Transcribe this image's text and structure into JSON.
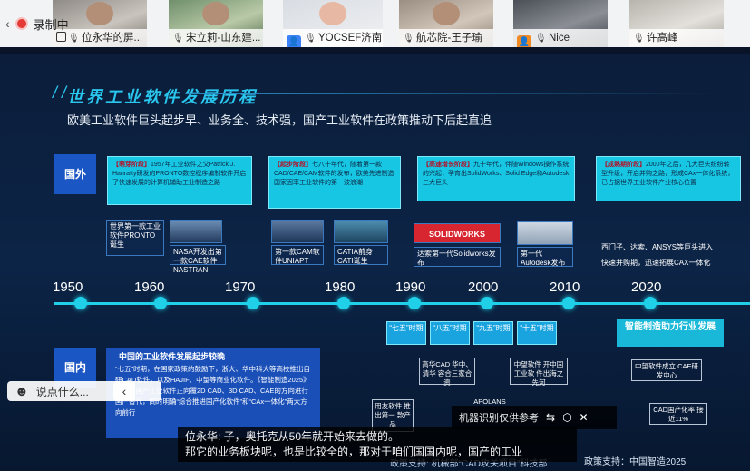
{
  "topbar": {
    "recording_label": "录制中",
    "participants": [
      {
        "name": "位永华的屏..."
      },
      {
        "name": "宋立莉-山东建..."
      },
      {
        "name": "YOCSEF济南"
      },
      {
        "name": "航芯院-王子瑜"
      },
      {
        "name": "Nice"
      },
      {
        "name": "许高峰"
      }
    ]
  },
  "slide": {
    "title": "世界工业软件发展历程",
    "subtitle": "欧美工业软件巨头起步早、业务全、技术强，国产工业软件在政策推动下后起直追",
    "row_foreign": "国外",
    "row_domestic": "国内",
    "foreign_boxes": [
      {
        "key": "【萌芽阶段】",
        "text": "1957年工业软件之父Patrick J. Hanratty研发的PRONTO数控程序编制软件开启了快速发展的计算机辅助工业制造之路"
      },
      {
        "key": "【起步阶段】",
        "text": "七八十年代，随着第一款CAD/CAE/CAM软件的发布，欧美先进制造国家因率工业软件的第一波浪潮"
      },
      {
        "key": "【高速增长阶段】",
        "text": "九十年代，伴随Windows操作系统的兴起，孕育出SolidWorks、Solid Edge和Autodesk三大巨头"
      },
      {
        "key": "【成熟期阶段】",
        "text": "2000年之后，几大巨头纷纷转型升级，开启并购之路，形成CAx一体化系统，已占据世界工业软件产业核心位置"
      }
    ],
    "events": [
      {
        "text": "世界第一款工业软件PRONTO诞生"
      },
      {
        "text": "NASA开发出第一款CAE软件NASTRAN"
      },
      {
        "text": "第一款CAM软件UNIAPT"
      },
      {
        "text": "CATIA前身CATI诞生"
      },
      {
        "text": "达索第一代Solidworks发布"
      },
      {
        "text": "第一代Autodesk发布"
      },
      {
        "text": "西门子、达索、ANSYS等巨头进入"
      },
      {
        "text": "快速并购期，迅速拓展CAX一体化"
      }
    ],
    "solidworks_logo": "SOLIDWORKS",
    "years": [
      "1950",
      "1960",
      "1970",
      "1980",
      "1990",
      "2000",
      "2010",
      "2020"
    ],
    "plans": [
      "“七五”时期",
      "“八五”时期",
      "“九五”时期",
      "“十五”时期"
    ],
    "mfg_box": "智能制造助力行业发展",
    "domestic_boxes": [
      "高华CAD 华中、清华 容合三家合资",
      "中望软件 开中国工业软 件出海之先河",
      "中望软件成立 CAE研发中心",
      "CAD国产化率 接近11%",
      "用友软件 推出第一 款产品",
      "APOLANS"
    ],
    "domestic_title": "中国的工业软件发展起步较晚",
    "domestic_text": "“七五”时期，在国家政策的鼓励下，浙大、华中科大等高校推出自研CAD软件，以及HAJIF、中望等商业化软件。《智能制造2025》发布，国产工业软件正向覆2D CAD、3D CAD、CAE的方向进行国产替代，同时明确“综合推进国产化软件”和“CAx一体化”两大方向前行",
    "footer_left": "政策支持: 机械部“CAD攻关项目”科技部",
    "footer_right": "政策支持：中国智造2025"
  },
  "overlays": {
    "chat_placeholder": "说点什么...",
    "caption_label": "机器识别仅供参考",
    "subtitle_line1": "位永华: 子，奥托克从50年就开始来去做的。",
    "subtitle_line2": "那它的业务板块呢，也是比较全的，那对于咱们国国内呢，国产的工业"
  }
}
